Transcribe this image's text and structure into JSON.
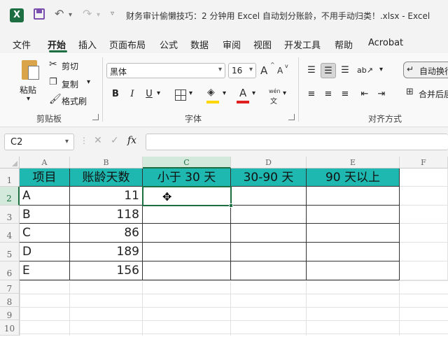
{
  "app": {
    "logo": "X",
    "title": "财务审计偷懒技巧：2 分钟用 Excel 自动划分账龄，不用手动归类！.xlsx  -  Excel"
  },
  "quick_access": {
    "undo": "↶",
    "redo": "↷"
  },
  "tabs": [
    "文件",
    "开始",
    "插入",
    "页面布局",
    "公式",
    "数据",
    "审阅",
    "视图",
    "开发工具",
    "帮助",
    "Acrobat"
  ],
  "active_tab": "开始",
  "ribbon": {
    "clipboard": {
      "paste": "粘贴",
      "cut": "剪切",
      "copy": "复制",
      "format_painter": "格式刷",
      "label": "剪贴板"
    },
    "font": {
      "name": "黑体",
      "size": "16",
      "grow": "A",
      "shrink": "A",
      "bold": "B",
      "italic": "I",
      "underline": "U",
      "fill_letter": "◈",
      "font_color_letter": "A",
      "phonetic": "wén",
      "label": "字体",
      "fill_color": "#ffd700",
      "font_color": "#e02020"
    },
    "alignment": {
      "wrap_text": "自动换行",
      "merge": "合并后居中",
      "label": "对齐方式"
    }
  },
  "formula_bar": {
    "name_box": "C2",
    "cancel": "✕",
    "enter": "✓",
    "fx": "fx",
    "value": ""
  },
  "columns": [
    "A",
    "B",
    "C",
    "D",
    "E",
    "F"
  ],
  "rows": [
    "1",
    "2",
    "3",
    "4",
    "5",
    "6",
    "7",
    "8",
    "9",
    "10"
  ],
  "selected_cell": "C2",
  "header_fill": "#1fb8b0",
  "table": {
    "headers": [
      "项目",
      "账龄天数",
      "小于 30 天",
      "30-90 天",
      "90 天以上"
    ],
    "rows": [
      [
        "A",
        "11",
        "",
        "",
        ""
      ],
      [
        "B",
        "118",
        "",
        "",
        ""
      ],
      [
        "C",
        "86",
        "",
        "",
        ""
      ],
      [
        "D",
        "189",
        "",
        "",
        ""
      ],
      [
        "E",
        "156",
        "",
        "",
        ""
      ]
    ]
  }
}
